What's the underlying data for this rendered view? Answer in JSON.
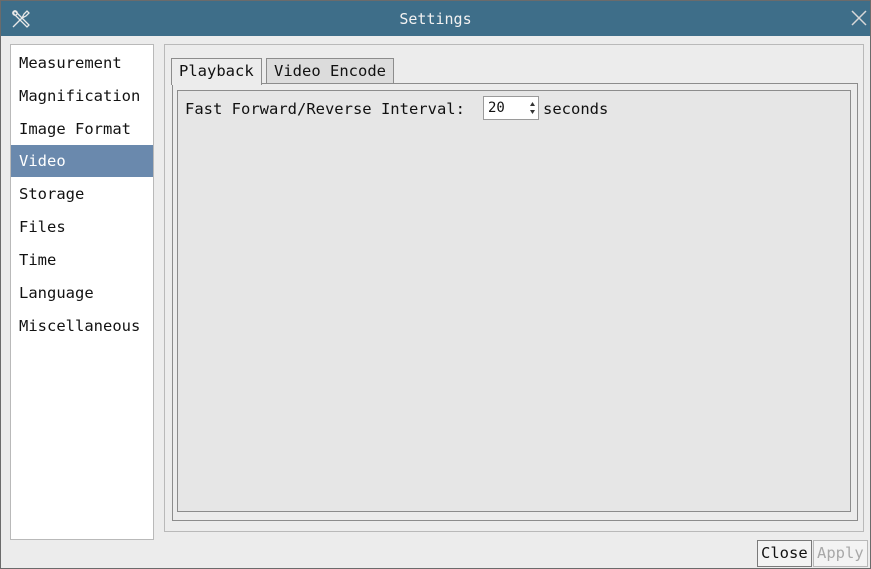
{
  "window": {
    "title": "Settings"
  },
  "sidebar": {
    "items": [
      {
        "label": "Measurement",
        "selected": false
      },
      {
        "label": "Magnification",
        "selected": false
      },
      {
        "label": "Image Format",
        "selected": false
      },
      {
        "label": "Video",
        "selected": true
      },
      {
        "label": "Storage",
        "selected": false
      },
      {
        "label": "Files",
        "selected": false
      },
      {
        "label": "Time",
        "selected": false
      },
      {
        "label": "Language",
        "selected": false
      },
      {
        "label": "Miscellaneous",
        "selected": false
      }
    ]
  },
  "tabs": [
    {
      "label": "Playback",
      "active": true
    },
    {
      "label": "Video Encode",
      "active": false
    }
  ],
  "playback": {
    "interval_label": "Fast Forward/Reverse Interval:",
    "interval_value": "20",
    "interval_unit": "seconds"
  },
  "buttons": {
    "close": "Close",
    "apply": "Apply"
  },
  "colors": {
    "titlebar": "#3e6e89",
    "selection": "#6a89ad"
  },
  "icons": {
    "title": "tools-icon",
    "close": "close-icon",
    "spin": "spin-arrows-icon"
  }
}
